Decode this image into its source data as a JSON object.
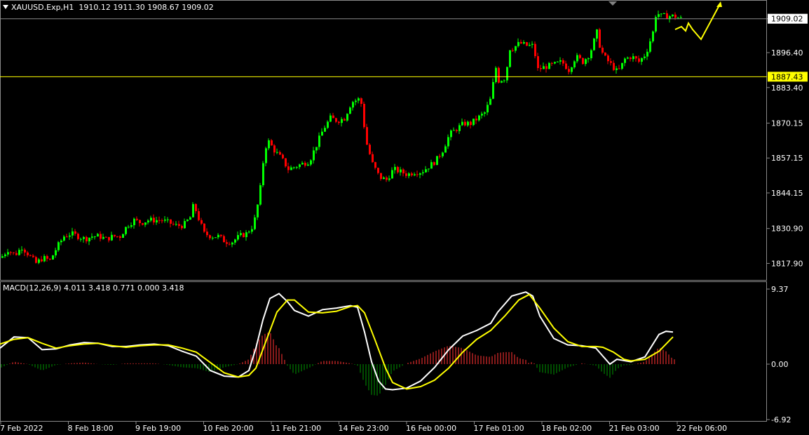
{
  "header": {
    "symbol": "XAUUSD.Exp,H1",
    "ohlc": "1910.12 1911.30 1908.67 1909.02",
    "macd_label": "MACD(12,26,9) 4.011 3.418 0.771 0.000 3.418"
  },
  "price_axis": {
    "ticks": [
      "1909.02",
      "1896.40",
      "1883.40",
      "1870.15",
      "1857.15",
      "1844.15",
      "1830.90",
      "1817.90"
    ],
    "current_price": "1909.02",
    "level_price": "1887.43"
  },
  "macd_axis": {
    "ticks": [
      "9.37",
      "0.00",
      "-6.92"
    ]
  },
  "time_axis": {
    "ticks": [
      "7 Feb 2022",
      "8 Feb 18:00",
      "9 Feb 19:00",
      "10 Feb 20:00",
      "11 Feb 21:00",
      "14 Feb 23:00",
      "16 Feb 00:00",
      "17 Feb 01:00",
      "18 Feb 02:00",
      "21 Feb 03:00",
      "22 Feb 06:00"
    ]
  },
  "colors": {
    "background": "#000000",
    "bull_candle": "#00ff00",
    "bear_candle": "#ff0000",
    "level_line": "#ffff00",
    "macd_line": "#ffffff",
    "signal_line": "#ffff00",
    "hist_pos": "#b22222",
    "hist_neg": "#006400"
  },
  "chart_data": [
    {
      "type": "candlestick",
      "title": "XAUUSD.Exp,H1",
      "ylim": [
        1812,
        1916
      ],
      "price_path": [
        [
          0,
          1820
        ],
        [
          10,
          1823
        ],
        [
          20,
          1821
        ],
        [
          30,
          1824
        ],
        [
          40,
          1821
        ],
        [
          50,
          1818
        ],
        [
          60,
          1820
        ],
        [
          70,
          1819
        ],
        [
          80,
          1824
        ],
        [
          90,
          1828
        ],
        [
          100,
          1829
        ],
        [
          110,
          1828
        ],
        [
          120,
          1827
        ],
        [
          130,
          1828
        ],
        [
          140,
          1828
        ],
        [
          150,
          1827
        ],
        [
          160,
          1828
        ],
        [
          170,
          1828
        ],
        [
          180,
          1832
        ],
        [
          190,
          1834
        ],
        [
          200,
          1833
        ],
        [
          210,
          1834
        ],
        [
          220,
          1834
        ],
        [
          230,
          1834
        ],
        [
          240,
          1833
        ],
        [
          250,
          1832
        ],
        [
          260,
          1832
        ],
        [
          270,
          1835
        ],
        [
          275,
          1840
        ],
        [
          280,
          1836
        ],
        [
          290,
          1829
        ],
        [
          300,
          1828
        ],
        [
          310,
          1828
        ],
        [
          320,
          1826
        ],
        [
          330,
          1826
        ],
        [
          340,
          1828
        ],
        [
          350,
          1829
        ],
        [
          360,
          1832
        ],
        [
          365,
          1838
        ],
        [
          370,
          1846
        ],
        [
          375,
          1858
        ],
        [
          380,
          1864
        ],
        [
          390,
          1860
        ],
        [
          400,
          1857
        ],
        [
          410,
          1853
        ],
        [
          420,
          1854
        ],
        [
          430,
          1855
        ],
        [
          440,
          1856
        ],
        [
          450,
          1862
        ],
        [
          460,
          1868
        ],
        [
          470,
          1872
        ],
        [
          480,
          1871
        ],
        [
          490,
          1872
        ],
        [
          500,
          1878
        ],
        [
          510,
          1879
        ],
        [
          515,
          1877
        ],
        [
          520,
          1864
        ],
        [
          530,
          1855
        ],
        [
          540,
          1850
        ],
        [
          550,
          1849
        ],
        [
          560,
          1853
        ],
        [
          570,
          1852
        ],
        [
          580,
          1851
        ],
        [
          590,
          1852
        ],
        [
          600,
          1852
        ],
        [
          610,
          1854
        ],
        [
          620,
          1856
        ],
        [
          630,
          1860
        ],
        [
          640,
          1866
        ],
        [
          650,
          1868
        ],
        [
          660,
          1870
        ],
        [
          670,
          1870
        ],
        [
          680,
          1872
        ],
        [
          690,
          1874
        ],
        [
          700,
          1880
        ],
        [
          705,
          1892
        ],
        [
          710,
          1886
        ],
        [
          720,
          1887
        ],
        [
          725,
          1898
        ],
        [
          730,
          1898
        ],
        [
          740,
          1900
        ],
        [
          750,
          1899
        ],
        [
          760,
          1899
        ],
        [
          765,
          1890
        ],
        [
          775,
          1891
        ],
        [
          790,
          1892
        ],
        [
          800,
          1893
        ],
        [
          810,
          1890
        ],
        [
          820,
          1895
        ],
        [
          830,
          1893
        ],
        [
          840,
          1896
        ],
        [
          850,
          1904
        ],
        [
          855,
          1898
        ],
        [
          860,
          1895
        ],
        [
          870,
          1892
        ],
        [
          880,
          1889
        ],
        [
          890,
          1894
        ],
        [
          900,
          1895
        ],
        [
          910,
          1893
        ],
        [
          920,
          1896
        ],
        [
          930,
          1904
        ],
        [
          935,
          1912
        ],
        [
          940,
          1910
        ],
        [
          950,
          1910
        ],
        [
          960,
          1910
        ],
        [
          970,
          1909
        ]
      ],
      "current_price": 1909.02,
      "horizontal_level": 1887.43
    },
    {
      "type": "line",
      "title": "MACD(12,26,9)",
      "ylim": [
        -6.92,
        9.37
      ],
      "series": [
        {
          "name": "MACD",
          "values": [
            [
              0,
              2.0
            ],
            [
              20,
              3.4
            ],
            [
              40,
              3.3
            ],
            [
              60,
              1.8
            ],
            [
              80,
              1.9
            ],
            [
              100,
              2.4
            ],
            [
              120,
              2.7
            ],
            [
              140,
              2.6
            ],
            [
              160,
              2.2
            ],
            [
              180,
              2.2
            ],
            [
              200,
              2.4
            ],
            [
              220,
              2.5
            ],
            [
              240,
              2.3
            ],
            [
              260,
              1.6
            ],
            [
              280,
              1.0
            ],
            [
              300,
              -0.8
            ],
            [
              320,
              -1.5
            ],
            [
              340,
              -1.6
            ],
            [
              355,
              -0.8
            ],
            [
              365,
              2.0
            ],
            [
              375,
              5.5
            ],
            [
              385,
              8.2
            ],
            [
              398,
              8.8
            ],
            [
              410,
              7.8
            ],
            [
              420,
              6.7
            ],
            [
              440,
              6.0
            ],
            [
              460,
              6.8
            ],
            [
              480,
              7.0
            ],
            [
              500,
              7.3
            ],
            [
              510,
              7.1
            ],
            [
              520,
              4.0
            ],
            [
              530,
              0.3
            ],
            [
              540,
              -2.1
            ],
            [
              550,
              -3.1
            ],
            [
              560,
              -3.2
            ],
            [
              580,
              -3.0
            ],
            [
              600,
              -2.1
            ],
            [
              620,
              -0.4
            ],
            [
              640,
              1.8
            ],
            [
              660,
              3.5
            ],
            [
              680,
              4.2
            ],
            [
              700,
              5.1
            ],
            [
              710,
              6.5
            ],
            [
              730,
              8.5
            ],
            [
              750,
              9.0
            ],
            [
              760,
              8.5
            ],
            [
              770,
              6.0
            ],
            [
              790,
              3.2
            ],
            [
              810,
              2.4
            ],
            [
              830,
              2.3
            ],
            [
              850,
              2.0
            ],
            [
              860,
              1.0
            ],
            [
              870,
              0.0
            ],
            [
              880,
              0.6
            ],
            [
              900,
              0.3
            ],
            [
              920,
              0.9
            ],
            [
              940,
              3.7
            ],
            [
              950,
              4.1
            ],
            [
              960,
              4.0
            ]
          ]
        },
        {
          "name": "Signal",
          "values": [
            [
              0,
              2.5
            ],
            [
              20,
              3.1
            ],
            [
              40,
              3.3
            ],
            [
              60,
              2.6
            ],
            [
              80,
              2.0
            ],
            [
              100,
              2.3
            ],
            [
              120,
              2.5
            ],
            [
              140,
              2.6
            ],
            [
              160,
              2.3
            ],
            [
              180,
              2.1
            ],
            [
              200,
              2.3
            ],
            [
              220,
              2.4
            ],
            [
              240,
              2.4
            ],
            [
              260,
              2.0
            ],
            [
              280,
              1.5
            ],
            [
              300,
              0.2
            ],
            [
              320,
              -1.1
            ],
            [
              340,
              -1.6
            ],
            [
              355,
              -1.4
            ],
            [
              365,
              -0.5
            ],
            [
              380,
              3.0
            ],
            [
              395,
              6.5
            ],
            [
              410,
              8.0
            ],
            [
              420,
              8.0
            ],
            [
              440,
              6.5
            ],
            [
              460,
              6.4
            ],
            [
              480,
              6.6
            ],
            [
              500,
              7.2
            ],
            [
              510,
              7.3
            ],
            [
              520,
              6.4
            ],
            [
              535,
              3.0
            ],
            [
              550,
              -0.5
            ],
            [
              560,
              -2.3
            ],
            [
              580,
              -3.1
            ],
            [
              600,
              -2.8
            ],
            [
              620,
              -2.0
            ],
            [
              640,
              -0.5
            ],
            [
              660,
              1.5
            ],
            [
              680,
              3.1
            ],
            [
              700,
              4.2
            ],
            [
              720,
              6.0
            ],
            [
              740,
              8.0
            ],
            [
              755,
              8.7
            ],
            [
              770,
              7.0
            ],
            [
              790,
              4.5
            ],
            [
              810,
              2.8
            ],
            [
              830,
              2.2
            ],
            [
              850,
              2.2
            ],
            [
              860,
              2.1
            ],
            [
              875,
              1.5
            ],
            [
              890,
              0.6
            ],
            [
              900,
              0.4
            ],
            [
              920,
              0.6
            ],
            [
              940,
              1.6
            ],
            [
              960,
              3.4
            ]
          ]
        }
      ]
    }
  ]
}
